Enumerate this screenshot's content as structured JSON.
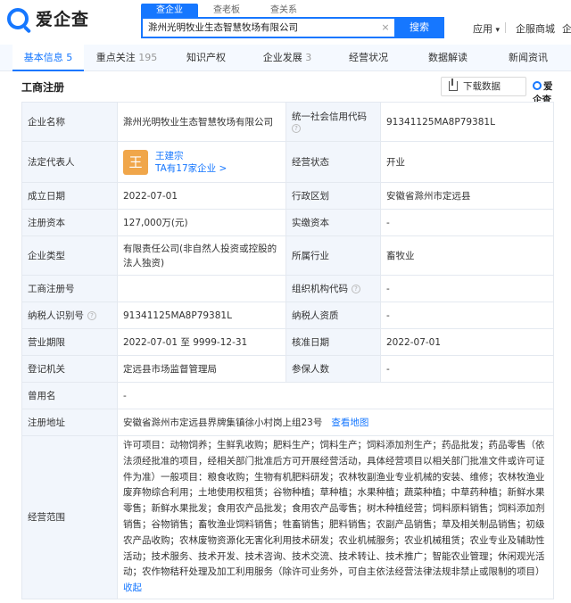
{
  "header": {
    "logo_text": "爱企查",
    "search_tabs": [
      "查企业",
      "查老板",
      "查关系"
    ],
    "search_value": "滁州光明牧业生态智慧牧场有限公司",
    "clear_icon": "×",
    "search_button": "搜索",
    "app_menu": "应用",
    "app_menu_caret": "▾",
    "enterprise_mall": "企服商城",
    "truncated_link": "企"
  },
  "nav": {
    "tabs": [
      {
        "label": "基本信息",
        "count": "5"
      },
      {
        "label": "重点关注",
        "count": "195"
      },
      {
        "label": "知识产权",
        "count": ""
      },
      {
        "label": "企业发展",
        "count": "3"
      },
      {
        "label": "经营状况",
        "count": ""
      },
      {
        "label": "数据解读",
        "count": ""
      },
      {
        "label": "新闻资讯",
        "count": ""
      }
    ]
  },
  "section": {
    "title": "工商注册",
    "download_label": "下载数据",
    "brand": "爱企查"
  },
  "info": {
    "company_name_label": "企业名称",
    "company_name": "滁州光明牧业生态智慧牧场有限公司",
    "credit_code_label": "统一社会信用代码",
    "credit_code": "91341125MA8P79381L",
    "legal_rep_label": "法定代表人",
    "legal_rep_avatar": "王",
    "legal_rep_name": "王建宗",
    "legal_rep_companies": "TA有17家企业 >",
    "status_label": "经营状态",
    "status": "开业",
    "established_label": "成立日期",
    "established": "2022-07-01",
    "region_label": "行政区划",
    "region": "安徽省滁州市定远县",
    "reg_capital_label": "注册资本",
    "reg_capital": "127,000万(元)",
    "paid_capital_label": "实缴资本",
    "paid_capital": "-",
    "type_label": "企业类型",
    "type_line1": "有限责任公司(非自然人投资或控股的",
    "type_line2": "法人独资)",
    "industry_label": "所属行业",
    "industry": "畜牧业",
    "reg_no_label": "工商注册号",
    "reg_no": "",
    "org_code_label": "组织机构代码",
    "org_code": "-",
    "taxpayer_id_label": "纳税人识别号",
    "taxpayer_id": "91341125MA8P79381L",
    "taxpayer_qual_label": "纳税人资质",
    "taxpayer_qual": "-",
    "term_label": "营业期限",
    "term": "2022-07-01 至 9999-12-31",
    "approval_date_label": "核准日期",
    "approval_date": "2022-07-01",
    "authority_label": "登记机关",
    "authority": "定远县市场监督管理局",
    "insured_label": "参保人数",
    "insured": "-",
    "former_name_label": "曾用名",
    "former_name": "-",
    "address_label": "注册地址",
    "address": "安徽省滁州市定远县界牌集镇徐小村岗上组23号",
    "view_map": "查看地图",
    "scope_label": "经营范围",
    "scope_lines": [
      "许可项目：动物饲养；生鲜乳收购；肥料生产；饲料生产；饲料添加剂生产；药品批发；药品零售（依",
      "法须经批准的项目，经相关部门批准后方可开展经营活动，具体经营项目以相关部门批准文件或许可证",
      "件为准）一般项目：粮食收购；生物有机肥料研发；农林牧副渔业专业机械的安装、维修；农林牧渔业",
      "废弃物综合利用；土地使用权租赁；谷物种植；草种植；水果种植；蔬菜种植；中草药种植；新鲜水果",
      "零售；新鲜水果批发；食用农产品批发；食用农产品零售；树木种植经营；饲料原料销售；饲料添加剂",
      "销售；谷物销售；畜牧渔业饲料销售；牲畜销售；肥料销售；农副产品销售；草及相关制品销售；初级",
      "农产品收购；农林废物资源化无害化利用技术研发；农业机械服务；农业机械租赁；农业专业及辅助性",
      "活动；技术服务、技术开发、技术咨询、技术交流、技术转让、技术推广；智能农业管理；休闲观光活",
      "动；农作物秸秆处理及加工利用服务（除许可业务外，可自主依法经营法律法规非禁止或限制的项目）"
    ],
    "collapse": "收起"
  },
  "colors": {
    "accent": "#1677ff",
    "label_bg": "#f2f6fc",
    "avatar": "#f0a64a"
  }
}
